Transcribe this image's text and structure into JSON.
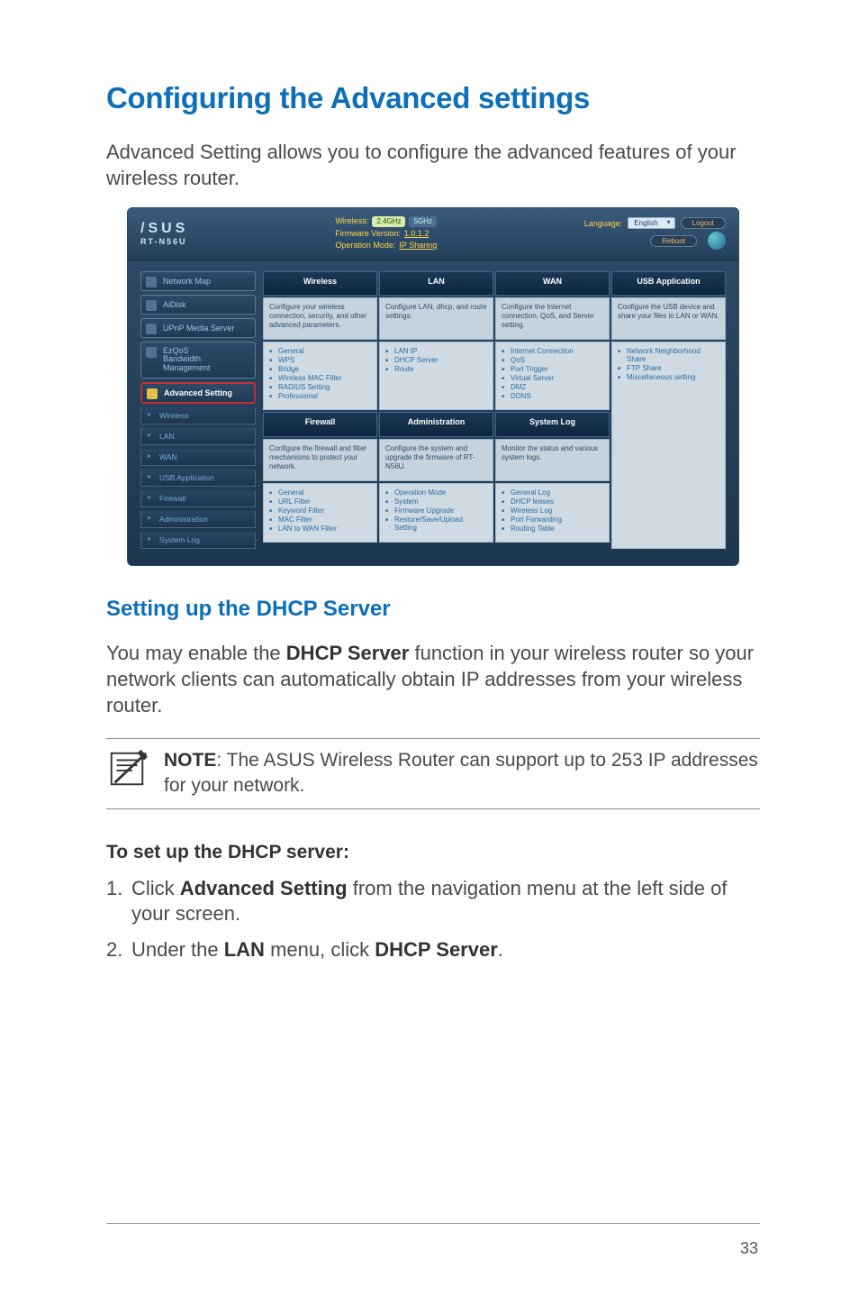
{
  "page_number": "33",
  "h1": "Configuring the Advanced settings",
  "intro": "Advanced Setting allows you to configure the advanced features of your wireless router.",
  "h2": "Setting up the DHCP Server",
  "p2_pre": "You may enable the ",
  "p2_bold": "DHCP Server",
  "p2_post": " function in your wireless router so your network clients can automatically obtain IP addresses from your wireless router.",
  "note_label": "NOTE",
  "note_sep": ": ",
  "note_text": "The ASUS Wireless Router can support up to 253 IP addresses for your network.",
  "steps_head": "To set up the DHCP server:",
  "steps": [
    {
      "pre": "Click ",
      "b": "Advanced Setting",
      "post": " from the navigation menu at the left side of your screen."
    },
    {
      "pre": "Under the ",
      "b": "LAN",
      "mid": " menu, click ",
      "b2": "DHCP Server",
      "post": "."
    }
  ],
  "shot": {
    "logo_brand": "/SUS",
    "model": "RT-N56U",
    "wireless_label": "Wireless:",
    "badge1": "2.4GHz",
    "badge2": "5GHz",
    "fw_label": "Firmware Version:",
    "fw_value": "1.0.1.2",
    "op_label": "Operation Mode:",
    "op_value": "IP Sharing",
    "lang_label": "Language:",
    "lang_value": "English",
    "btn_logout": "Logout",
    "btn_reboot": "Reboot",
    "side_main": [
      "Network Map",
      "AiDisk",
      "UPnP Media Server",
      "EzQoS\nBandwidth\nManagement"
    ],
    "side_adv": "Advanced Setting",
    "side_sub": [
      "Wireless",
      "LAN",
      "WAN",
      "USB Application",
      "Firewall",
      "Administration",
      "System Log"
    ],
    "cols": [
      {
        "head": "Wireless",
        "desc": "Configure your wireless connection, security, and other advanced parameters.",
        "items": [
          "General",
          "WPS",
          "Bridge",
          "Wireless MAC Filter",
          "RADIUS Setting",
          "Professional"
        ]
      },
      {
        "head": "LAN",
        "desc": "Configure LAN, dhcp, and route settings.",
        "items": [
          "LAN IP",
          "DHCP Server",
          "Route"
        ]
      },
      {
        "head": "WAN",
        "desc": "Configure the Internet connection, QoS, and Server setting.",
        "items": [
          "Internet Connection",
          "QoS",
          "Port Trigger",
          "Virtual Server",
          "DMZ",
          "DDNS"
        ]
      },
      {
        "head": "USB Application",
        "desc": "Configure the USB device and share your files in LAN or WAN.",
        "items": [
          "Network Neighborhood Share",
          "FTP Share",
          "Miscellaneous setting"
        ]
      }
    ],
    "cols2": [
      {
        "head": "Firewall",
        "desc": "Configure the firewall and filter mechanisms to protect your network.",
        "items": [
          "General",
          "URL Filter",
          "Keyword Filter",
          "MAC Filter",
          "LAN to WAN Filter"
        ]
      },
      {
        "head": "Administration",
        "desc": "Configure the system and upgrade the firmware of RT-N56U.",
        "items": [
          "Operation Mode",
          "System",
          "Firmware Upgrade",
          "Restore/Save/Upload Setting"
        ]
      },
      {
        "head": "System Log",
        "desc": "Monitor the status and various system logs.",
        "items": [
          "General Log",
          "DHCP leases",
          "Wireless Log",
          "Port Forwarding",
          "Routing Table"
        ]
      }
    ]
  }
}
